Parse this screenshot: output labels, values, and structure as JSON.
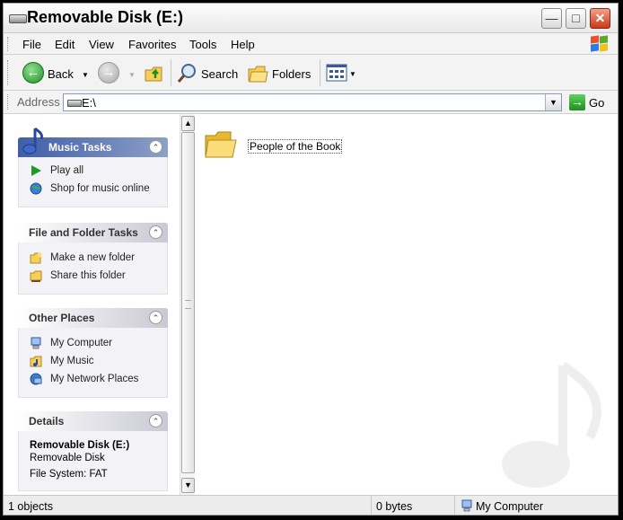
{
  "window": {
    "title": "Removable Disk (E:)"
  },
  "menu": {
    "items": [
      "File",
      "Edit",
      "View",
      "Favorites",
      "Tools",
      "Help"
    ]
  },
  "toolbar": {
    "back_label": "Back",
    "search_label": "Search",
    "folders_label": "Folders"
  },
  "address": {
    "label": "Address",
    "value": "E:\\",
    "go_label": "Go"
  },
  "panels": {
    "music_tasks": {
      "title": "Music Tasks",
      "items": [
        {
          "label": "Play all",
          "icon": "play-icon"
        },
        {
          "label": "Shop for music online",
          "icon": "globe-icon"
        }
      ]
    },
    "file_folder_tasks": {
      "title": "File and Folder Tasks",
      "items": [
        {
          "label": "Make a new folder",
          "icon": "new-folder-icon"
        },
        {
          "label": "Share this folder",
          "icon": "share-folder-icon"
        }
      ]
    },
    "other_places": {
      "title": "Other Places",
      "items": [
        {
          "label": "My Computer",
          "icon": "my-computer-icon"
        },
        {
          "label": "My Music",
          "icon": "my-music-icon"
        },
        {
          "label": "My Network Places",
          "icon": "network-places-icon"
        }
      ]
    },
    "details": {
      "title": "Details",
      "name": "Removable Disk (E:)",
      "type": "Removable Disk",
      "filesystem": "File System: FAT"
    }
  },
  "content": {
    "items": [
      {
        "label": "People of the Book",
        "icon": "folder-icon"
      }
    ]
  },
  "status": {
    "objects": "1 objects",
    "size": "0 bytes",
    "location": "My Computer"
  },
  "colors": {
    "music_header": "#3f5ea8",
    "panel_body": "#f3f3f7",
    "close_button": "#c93a17"
  }
}
